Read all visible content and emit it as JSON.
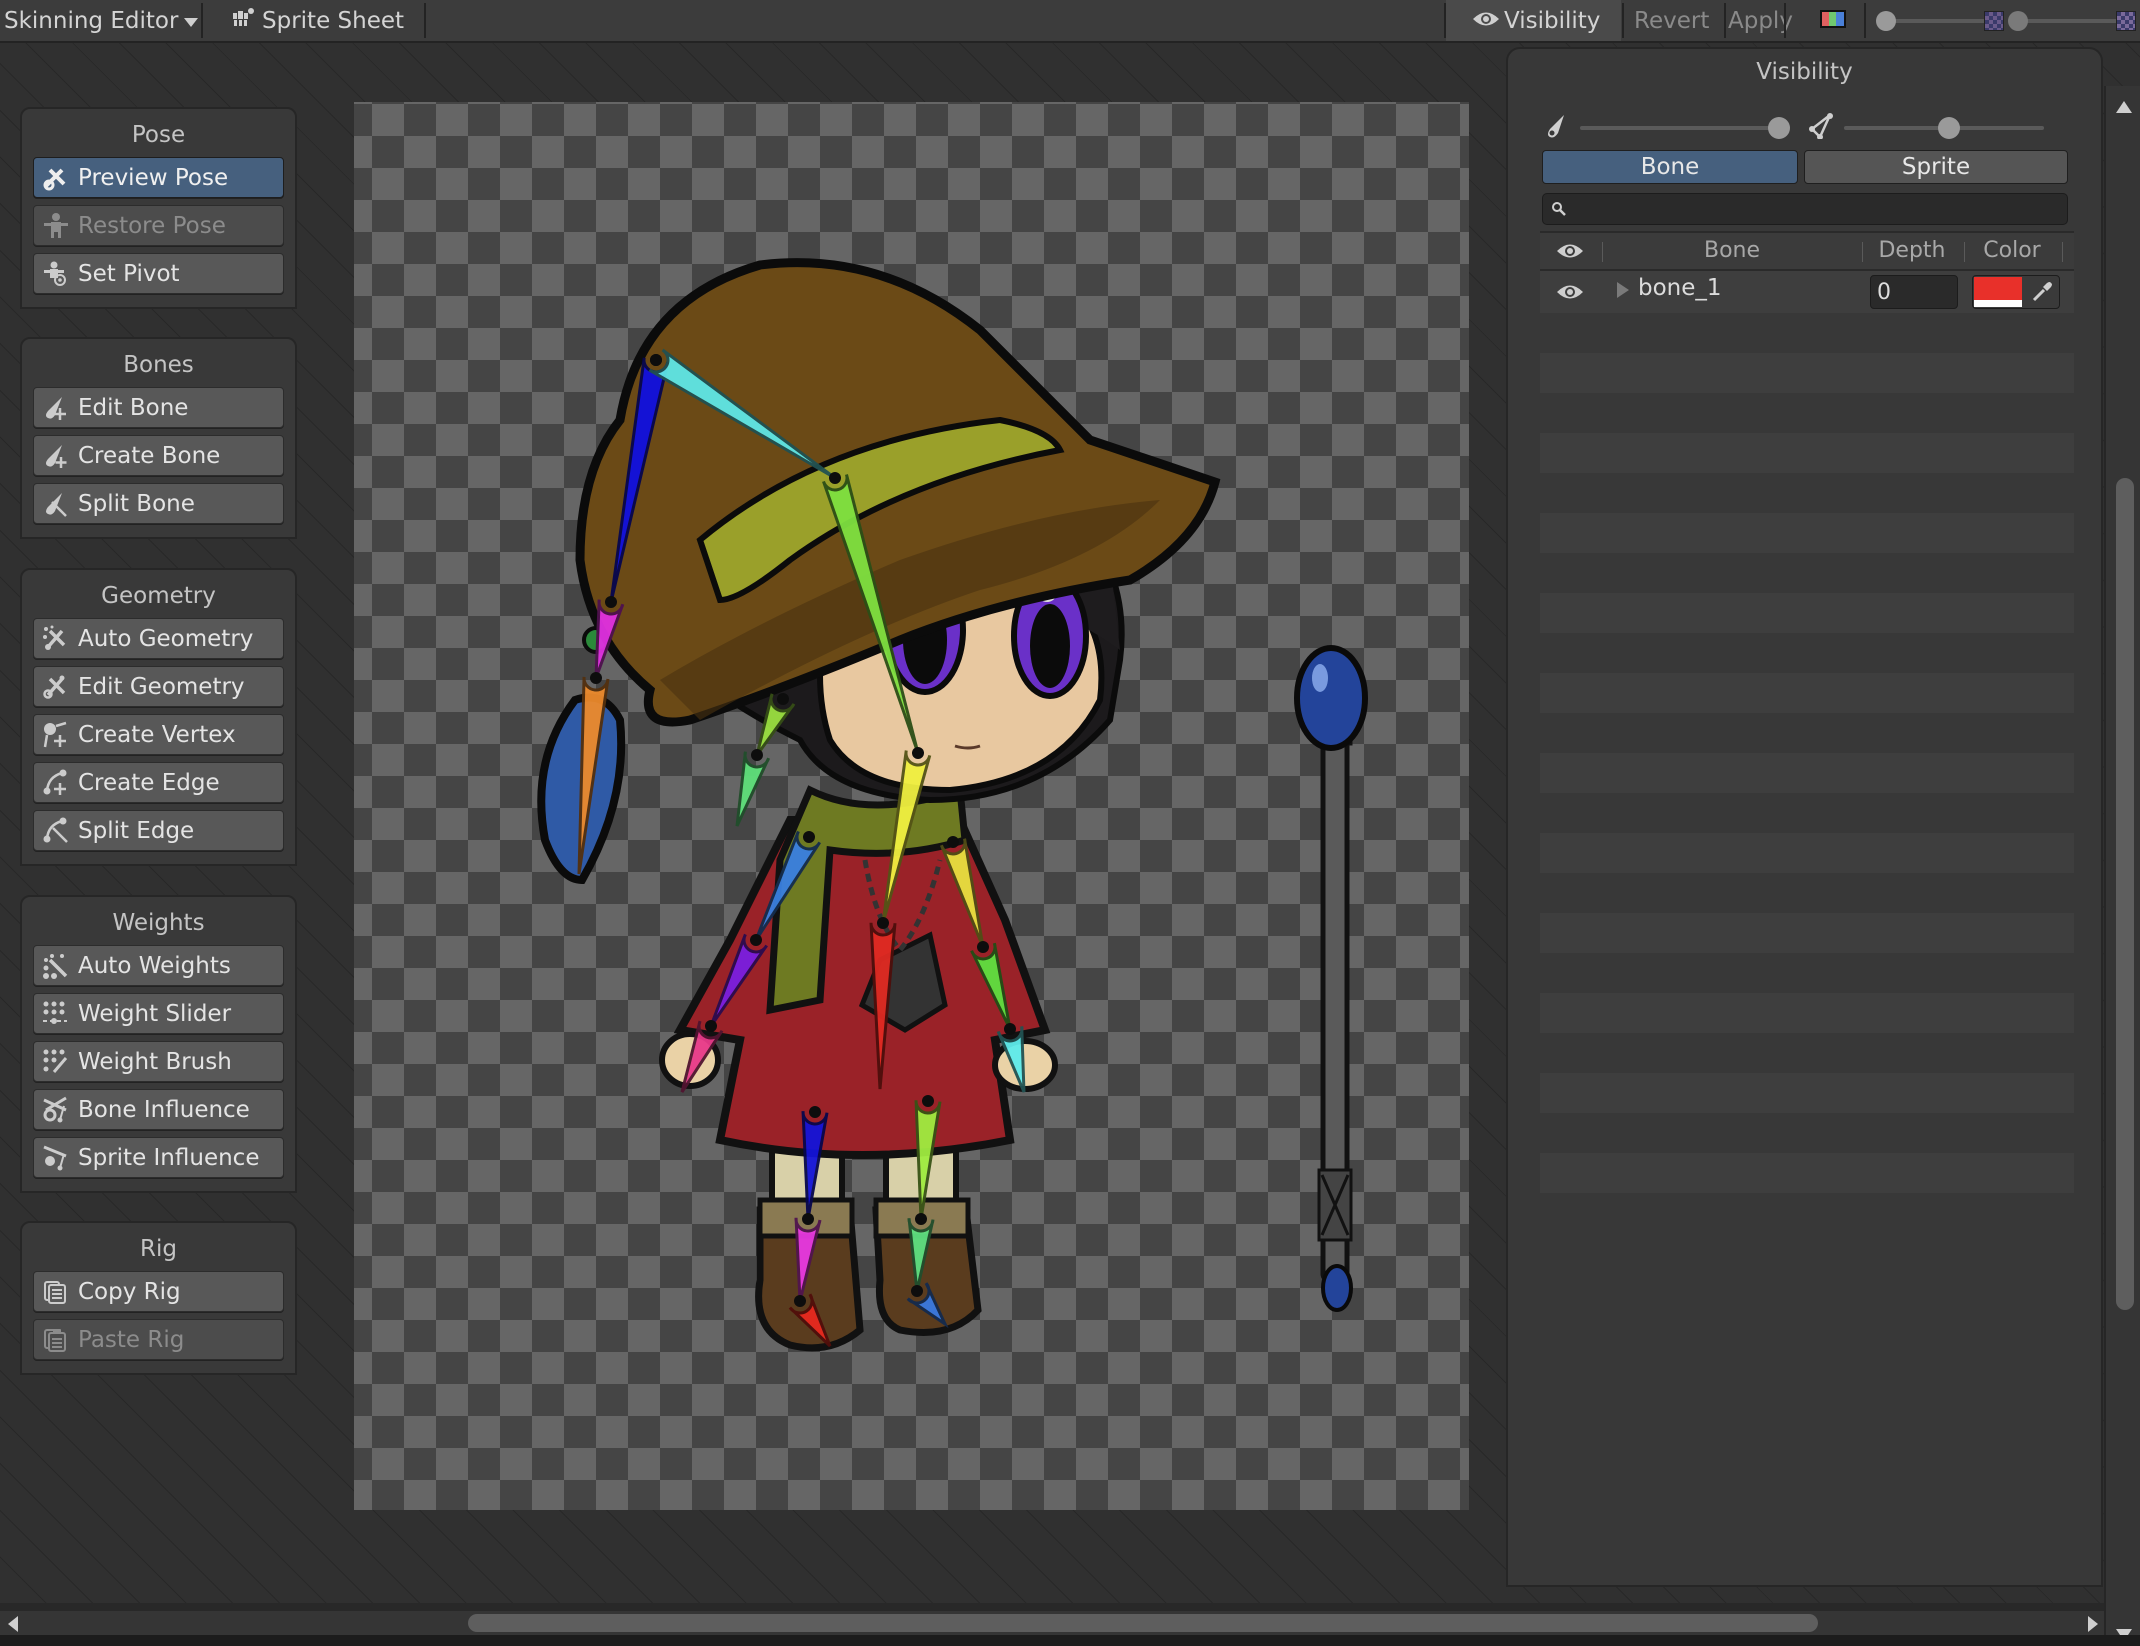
{
  "toolbar": {
    "editor_menu": "Skinning Editor",
    "sprite_sheet": "Sprite Sheet",
    "visibility": "Visibility",
    "revert": "Revert",
    "apply": "Apply",
    "icons": {
      "editor_dropdown": "chevron-down-icon",
      "sprite_sheet": "sprite-sheet-icon",
      "visibility": "eye-icon",
      "color_mode": "rgb-channels-icon",
      "brightness": "brightness-slider",
      "alpha": "alpha-slider"
    },
    "sliders": {
      "brightness_value": 0.0,
      "alpha_value": 0.0
    }
  },
  "tool_panels": [
    {
      "title": "Pose",
      "buttons": [
        {
          "label": "Preview Pose",
          "icon": "preview-pose-icon",
          "state": "active"
        },
        {
          "label": "Restore Pose",
          "icon": "restore-pose-icon",
          "state": "disabled"
        },
        {
          "label": "Set Pivot",
          "icon": "set-pivot-icon",
          "state": "normal"
        }
      ]
    },
    {
      "title": "Bones",
      "buttons": [
        {
          "label": "Edit Bone",
          "icon": "edit-bone-icon",
          "state": "normal"
        },
        {
          "label": "Create Bone",
          "icon": "create-bone-icon",
          "state": "normal"
        },
        {
          "label": "Split Bone",
          "icon": "split-bone-icon",
          "state": "normal"
        }
      ]
    },
    {
      "title": "Geometry",
      "buttons": [
        {
          "label": "Auto Geometry",
          "icon": "auto-geometry-icon",
          "state": "normal"
        },
        {
          "label": "Edit Geometry",
          "icon": "edit-geometry-icon",
          "state": "normal"
        },
        {
          "label": "Create Vertex",
          "icon": "create-vertex-icon",
          "state": "normal"
        },
        {
          "label": "Create Edge",
          "icon": "create-edge-icon",
          "state": "normal"
        },
        {
          "label": "Split Edge",
          "icon": "split-edge-icon",
          "state": "normal"
        }
      ]
    },
    {
      "title": "Weights",
      "buttons": [
        {
          "label": "Auto Weights",
          "icon": "auto-weights-icon",
          "state": "normal"
        },
        {
          "label": "Weight Slider",
          "icon": "weight-slider-icon",
          "state": "normal"
        },
        {
          "label": "Weight Brush",
          "icon": "weight-brush-icon",
          "state": "normal"
        },
        {
          "label": "Bone Influence",
          "icon": "bone-influence-icon",
          "state": "normal"
        },
        {
          "label": "Sprite Influence",
          "icon": "sprite-influence-icon",
          "state": "normal"
        }
      ]
    },
    {
      "title": "Rig",
      "buttons": [
        {
          "label": "Copy Rig",
          "icon": "copy-rig-icon",
          "state": "normal"
        },
        {
          "label": "Paste Rig",
          "icon": "paste-rig-icon",
          "state": "disabled"
        }
      ]
    }
  ],
  "visibility_panel": {
    "title": "Visibility",
    "bone_opacity": 1.0,
    "mesh_opacity": 0.5,
    "tabs": [
      {
        "label": "Bone",
        "selected": true
      },
      {
        "label": "Sprite",
        "selected": false
      }
    ],
    "search": {
      "value": "",
      "placeholder": ""
    },
    "columns": [
      "Bone",
      "Depth",
      "Color"
    ],
    "rows": [
      {
        "name": "bone_1",
        "visible": true,
        "expanded": false,
        "depth": "0",
        "color": "#e8302a"
      }
    ],
    "empty_row_count": 23
  },
  "colors": {
    "accent": "#46607e",
    "bone_1_color": "#e8302a"
  },
  "scrollbars": {
    "vertical_thumb_fraction": 0.56,
    "horizontal_thumb_fraction": 0.64
  },
  "scene": {
    "description": "Chibi character sprite with colored skeleton bones and a staff sprite",
    "bones": [
      {
        "color": "#1010e0"
      },
      {
        "color": "#5fe6e6"
      },
      {
        "color": "#e030e0"
      },
      {
        "color": "#ec8a2c"
      },
      {
        "color": "#7ee040"
      },
      {
        "color": "#f0f040"
      },
      {
        "color": "#e02a22"
      },
      {
        "color": "#9be040"
      },
      {
        "color": "#5ee07a"
      },
      {
        "color": "#3a80e0"
      },
      {
        "color": "#7a1ee0"
      },
      {
        "color": "#e83a8a"
      },
      {
        "color": "#e8e040"
      },
      {
        "color": "#5ee040"
      },
      {
        "color": "#5eecec"
      },
      {
        "color": "#1414d8"
      },
      {
        "color": "#e838e0"
      },
      {
        "color": "#e8281e"
      },
      {
        "color": "#a0ec40"
      },
      {
        "color": "#5ee080"
      },
      {
        "color": "#3a7ae0"
      }
    ]
  }
}
